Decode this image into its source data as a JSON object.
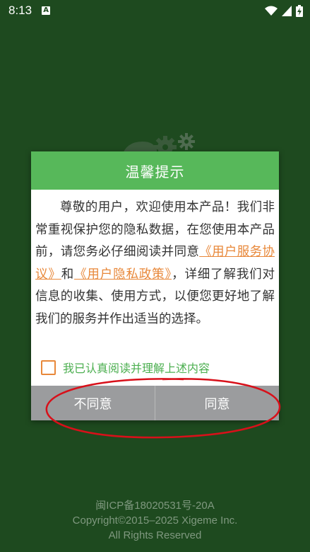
{
  "status_bar": {
    "time": "8:13",
    "app_icon_letter": "A"
  },
  "dialog": {
    "title": "温馨提示",
    "body_part1": "尊敬的用户，欢迎使用本产品！我们非常重视保护您的隐私数据，在您使用本产品前，请您务必仔细阅读并同意",
    "link_service": "《用户服务协议》",
    "and_text": "和",
    "link_privacy": "《用户隐私政策》",
    "body_part2": "，详细了解我们对信息的收集、使用方式，以便您更好地了解我们的服务并作出适当的选择。",
    "agree_checkbox_label": "我已认真阅读并理解上述内容",
    "agree_checked": false,
    "disagree_button": "不同意",
    "agree_button": "同意"
  },
  "footer": {
    "icp": "闽ICP备18020531号-20A",
    "copyright": "Copyright©2015–2025 Xigeme Inc.",
    "rights": "All Rights Reserved"
  },
  "colors": {
    "background": "#1e4a1f",
    "header": "#57b85a",
    "link": "#e8883a",
    "buttons": "#9b9c9e",
    "annotation": "#d8101a"
  },
  "icons": [
    "wifi-icon",
    "signal-icon",
    "battery-icon",
    "gear-logo-icon"
  ]
}
